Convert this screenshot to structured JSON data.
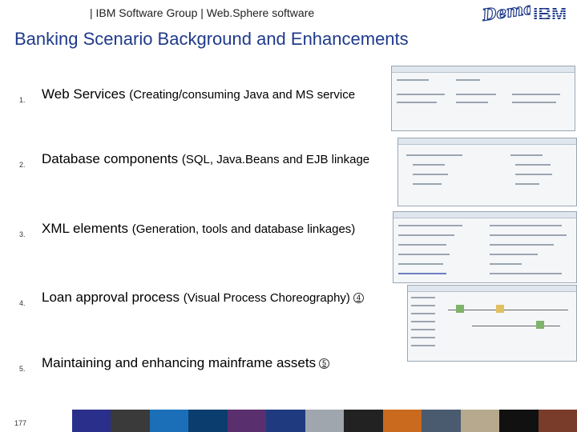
{
  "header": {
    "breadcrumb": "| IBM Software Group | Web.Sphere software",
    "demo_logo": "Demos",
    "ibm_logo": "IBM"
  },
  "title": "Banking Scenario Background and Enhancements",
  "items": [
    {
      "num": "1.",
      "main": "Web Services",
      "sub": "(Creating/consuming Java and MS service"
    },
    {
      "num": "2.",
      "main": "Database components",
      "sub": "(SQL, Java.Beans and EJB linkage"
    },
    {
      "num": "3.",
      "main": "XML elements",
      "sub": "(Generation, tools and database linkages)"
    },
    {
      "num": "4.",
      "main": "Loan approval process",
      "sub": "(Visual Process Choreography)",
      "ref": "4"
    },
    {
      "num": "5.",
      "main": "Maintaining and enhancing mainframe assets",
      "ref": "5"
    }
  ],
  "page_number": "177",
  "colors": {
    "title": "#1f3a8a",
    "strip": [
      "#2a2f8c",
      "#3a3a3a",
      "#1b6fb8",
      "#0b3d6e",
      "#5a2f6e",
      "#203a80",
      "#a0a6ad",
      "#222",
      "#c96a1e",
      "#4a5b70",
      "#b7a98e",
      "#111",
      "#7a3c2a"
    ]
  }
}
